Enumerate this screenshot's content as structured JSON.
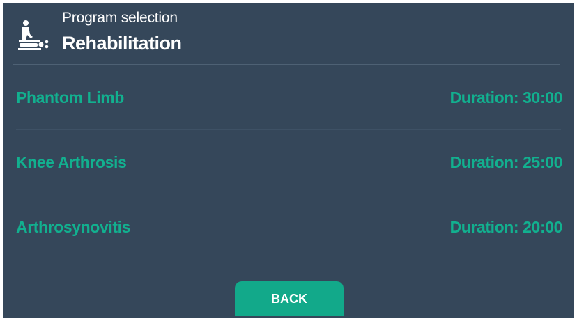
{
  "header": {
    "subtitle": "Program selection",
    "title": "Rehabilitation",
    "icon": "massage-therapy-icon"
  },
  "programs": [
    {
      "name": "Phantom Limb",
      "duration": "Duration: 30:00"
    },
    {
      "name": "Knee Arthrosis",
      "duration": "Duration: 25:00"
    },
    {
      "name": "Arthrosynovitis",
      "duration": "Duration: 20:00"
    }
  ],
  "footer": {
    "back_label": "BACK"
  },
  "colors": {
    "background": "#35475a",
    "accent": "#12b08f",
    "button": "#12a98a",
    "text": "#ffffff"
  }
}
